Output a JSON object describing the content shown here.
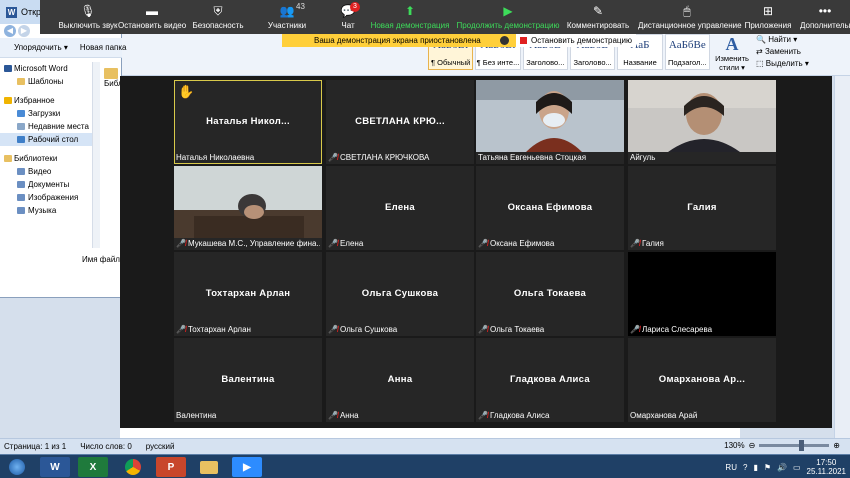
{
  "zoom_toolbar": {
    "mute_label": "Выключить звук",
    "stop_video_label": "Остановить видео",
    "security_label": "Безопасность",
    "participants_label": "Участники",
    "participants_count": "43",
    "chat_label": "Чат",
    "chat_badge": "3",
    "new_share_label": "Новая демонстрация",
    "resume_share_label": "Продолжить демонстрацию",
    "annotate_label": "Комментировать",
    "remote_control_label": "Дистанционное управление",
    "apps_label": "Приложения",
    "more_label": "Дополнительно"
  },
  "share_banner": {
    "message": "Ваша демонстрация экрана приостановлена",
    "stop_label": "Остановить демонстрацию"
  },
  "tiles": [
    {
      "name": "Наталья Николаевна",
      "center": "Наталья Никол...",
      "muted": false,
      "hand": true,
      "speaking": true,
      "kind": "name"
    },
    {
      "name": "СВЕТЛАНА КРЮЧКОВА",
      "center": "СВЕТЛАНА КРЮ...",
      "muted": true,
      "kind": "name"
    },
    {
      "name": "Татьяна Евгеньевна Стоцкая",
      "center": "",
      "muted": false,
      "kind": "video1"
    },
    {
      "name": "Айгуль",
      "center": "",
      "muted": false,
      "kind": "video2"
    },
    {
      "name": "Мукашева М.С., Управление фина...",
      "center": "",
      "muted": true,
      "kind": "video3"
    },
    {
      "name": "Елена",
      "center": "Елена",
      "muted": true,
      "kind": "name"
    },
    {
      "name": "Оксана Ефимова",
      "center": "Оксана Ефимова",
      "muted": true,
      "kind": "name"
    },
    {
      "name": "Галия",
      "center": "Галия",
      "muted": true,
      "kind": "name"
    },
    {
      "name": "Тохтархан Арлан",
      "center": "Тохтархан Арлан",
      "muted": true,
      "kind": "name"
    },
    {
      "name": "Ольга Сушкова",
      "center": "Ольга Сушкова",
      "muted": true,
      "kind": "name"
    },
    {
      "name": "Ольга Токаева",
      "center": "Ольга Токаева",
      "muted": true,
      "kind": "name"
    },
    {
      "name": "Лариса Слесарева",
      "center": "",
      "muted": true,
      "kind": "blank"
    },
    {
      "name": "Валентина",
      "center": "Валентина",
      "muted": false,
      "kind": "name"
    },
    {
      "name": "Анна",
      "center": "Анна",
      "muted": true,
      "kind": "name"
    },
    {
      "name": "Гладкова Алиса",
      "center": "Гладкова Алиса",
      "muted": true,
      "kind": "name"
    },
    {
      "name": "Омарханова Арай",
      "center": "Омарханова Ар...",
      "muted": false,
      "kind": "name"
    }
  ],
  "explorer": {
    "title": "Открытие",
    "organize_label": "Упорядочить ▾",
    "new_folder_label": "Новая папка",
    "nav": [
      {
        "label": "Microsoft Word",
        "top": true,
        "color": "#2b5797"
      },
      {
        "label": "Шаблоны",
        "color": "#e8c061"
      },
      {
        "label": "Избранное",
        "top": true,
        "gap": true,
        "color": "#f0b400"
      },
      {
        "label": "Загрузки",
        "color": "#4a8bd6"
      },
      {
        "label": "Недавние места",
        "color": "#8aa7c8"
      },
      {
        "label": "Рабочий стол",
        "color": "#3f7fc8",
        "sel": true
      },
      {
        "label": "Библиотеки",
        "top": true,
        "gap": true,
        "color": "#e8c061"
      },
      {
        "label": "Видео",
        "color": "#6b8fc2"
      },
      {
        "label": "Документы",
        "color": "#6b8fc2"
      },
      {
        "label": "Изображения",
        "color": "#6b8fc2"
      },
      {
        "label": "Музыка",
        "color": "#6b8fc2"
      }
    ],
    "library_label": "Библиотеки",
    "filename_label": "Имя файл"
  },
  "word": {
    "styles": [
      {
        "sample": "АаБбВі",
        "name": "¶ Обычный",
        "sel": true
      },
      {
        "sample": "АаБбВі",
        "name": "¶ Без инте..."
      },
      {
        "sample": "АаБбВ",
        "name": "Заголово..."
      },
      {
        "sample": "АаБбВ",
        "name": "Заголово..."
      },
      {
        "sample": "АаБ",
        "name": "Название"
      },
      {
        "sample": "АаБбВе",
        "name": "Подзагол..."
      }
    ],
    "change_styles_label": "Изменить стили ▾",
    "find_label": "Найти ▾",
    "replace_label": "Заменить",
    "select_label": "Выделить ▾",
    "status_page": "Страница: 1 из 1",
    "status_words": "Число слов: 0",
    "status_lang": "русский",
    "zoom_level": "130%"
  },
  "taskbar": {
    "lang": "RU",
    "time": "17:50",
    "date": "25.11.2021"
  },
  "colors": {
    "zoom_bg": "#1a1a1a",
    "tile_bg": "#262626",
    "zoom_green": "#3ddc5a",
    "banner_yellow": "#ffcf3a",
    "muted_red": "#e02020"
  }
}
